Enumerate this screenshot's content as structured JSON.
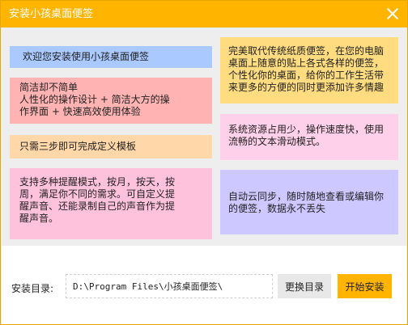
{
  "window": {
    "title": "安装小孩桌面便签",
    "close_icon": "close-icon"
  },
  "colors": {
    "title_bar": "#ffb400",
    "install_button": "#ffb400",
    "change_button": "#e8e8e8"
  },
  "notes": [
    {
      "text": "欢迎您安装使用小孩桌面便签",
      "color": "#a9c9ff"
    },
    {
      "text": "简洁却不简单\n人性化的操作设计 + 简洁大方的操\n作界面 + 快速高效使用体验",
      "color": "#ffb3b3"
    },
    {
      "text": "只需三步即可完成定义模板",
      "color": "#ffd7a8"
    },
    {
      "text": "支持多种提醒模式，按月，按天，按\n周，满足你不同的需求。可自定义提\n醒声音、还能录制自己的声音作为提\n醒声音。",
      "color": "#ffc2dc"
    },
    {
      "text": "完美取代传统纸质便签，在您的电脑\n桌面上随意的贴上各式各样的便签，\n个性化你的桌面，给你的工作生活带\n来更多的方便的同时更添加许多情趣",
      "color": "#ffdc80"
    },
    {
      "text": "系统资源占用少，操作速度快，使用\n流畅的文本滑动模式。",
      "color": "#ffd0ea"
    },
    {
      "text": "自动云同步，随时随地查看或编辑你\n的便签，数据永不丢失",
      "color": "#cdc8ff"
    }
  ],
  "install": {
    "dir_label": "安装目录:",
    "dir_value": "D:\\Program Files\\小孩桌面便签\\",
    "change_button": "更换目录",
    "install_button": "开始安装"
  }
}
